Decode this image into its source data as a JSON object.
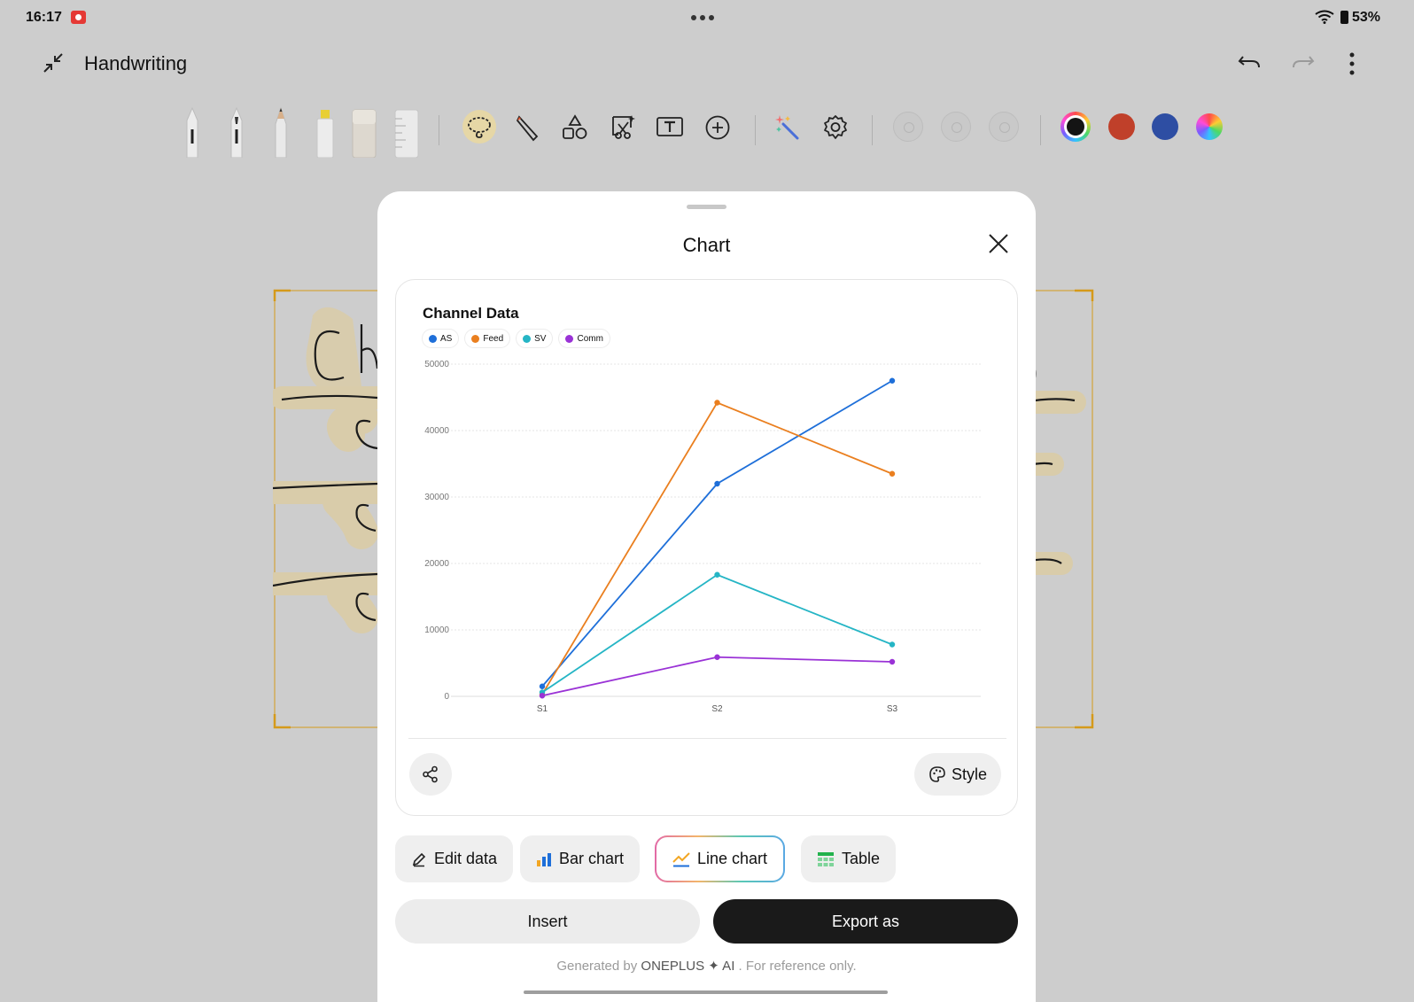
{
  "status_bar": {
    "time": "16:17",
    "battery": "53%"
  },
  "app_bar": {
    "title": "Handwriting"
  },
  "toolbar": {
    "tools": [
      "fountain-pen",
      "ballpoint-pen",
      "pencil",
      "highlighter",
      "eraser",
      "ruler",
      "lasso",
      "pen-tip",
      "shapes",
      "select-area",
      "text-box",
      "add",
      "magic-wand",
      "settings"
    ],
    "colors": [
      "#141414",
      "#c0402a",
      "#2e4ea3"
    ]
  },
  "sheet": {
    "title": "Chart",
    "chart_data": {
      "type": "line",
      "title": "Channel Data",
      "categories": [
        "S1",
        "S2",
        "S3"
      ],
      "series": [
        {
          "name": "AS",
          "color": "#1e6fd9",
          "values": [
            1500,
            32000,
            47500
          ]
        },
        {
          "name": "Feed",
          "color": "#ea7f1f",
          "values": [
            300,
            44200,
            33500
          ]
        },
        {
          "name": "SV",
          "color": "#25b5c5",
          "values": [
            600,
            18300,
            7800
          ]
        },
        {
          "name": "Comm",
          "color": "#9a32d6",
          "values": [
            100,
            5900,
            5200
          ]
        }
      ],
      "yticks": [
        "0",
        "10000",
        "20000",
        "30000",
        "40000",
        "50000"
      ],
      "ylim": [
        0,
        50000
      ],
      "grid": true,
      "legend_position": "top-left"
    },
    "style_label": "Style",
    "chips": {
      "edit": "Edit data",
      "bar": "Bar chart",
      "line": "Line chart",
      "table": "Table"
    },
    "insert_label": "Insert",
    "export_label": "Export as",
    "footer": {
      "prefix": "Generated by ",
      "brand": "ONEPLUS ✦ AI",
      "suffix": " . For reference only."
    }
  }
}
